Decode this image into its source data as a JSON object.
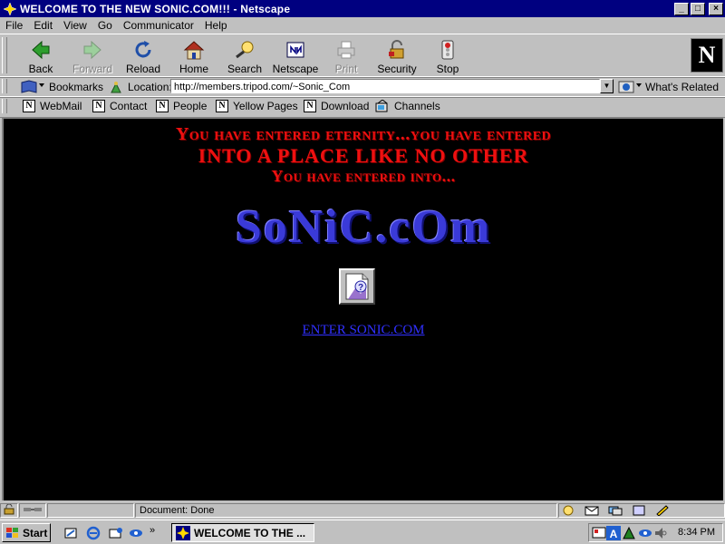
{
  "window": {
    "title": "WELCOME TO THE NEW SONIC.COM!!! - Netscape",
    "controls": {
      "minimize": "_",
      "maximize": "□",
      "close": "×"
    }
  },
  "menu": [
    "File",
    "Edit",
    "View",
    "Go",
    "Communicator",
    "Help"
  ],
  "toolbar": {
    "buttons": [
      {
        "label": "Back",
        "icon": "back-arrow-icon",
        "enabled": true
      },
      {
        "label": "Forward",
        "icon": "forward-arrow-icon",
        "enabled": false
      },
      {
        "label": "Reload",
        "icon": "reload-icon",
        "enabled": true
      },
      {
        "label": "Home",
        "icon": "home-icon",
        "enabled": true
      },
      {
        "label": "Search",
        "icon": "search-icon",
        "enabled": true
      },
      {
        "label": "Netscape",
        "icon": "netscape-icon",
        "enabled": true
      },
      {
        "label": "Print",
        "icon": "print-icon",
        "enabled": false
      },
      {
        "label": "Security",
        "icon": "lock-icon",
        "enabled": true
      },
      {
        "label": "Stop",
        "icon": "stop-icon",
        "enabled": true
      }
    ],
    "logo": "N"
  },
  "location_bar": {
    "bookmarks_label": "Bookmarks",
    "location_label": "Location:",
    "url": "http://members.tripod.com/~Sonic_Com",
    "whats_related": "What's Related"
  },
  "personal_toolbar": [
    "WebMail",
    "Contact",
    "People",
    "Yellow Pages",
    "Download",
    "Channels"
  ],
  "page": {
    "line1": "You have entered eternity...you have entered",
    "line2": "INTO A PLACE LIKE NO OTHER",
    "line3": "You have entered into...",
    "logo_text": "SoNiC.cOm",
    "enter_link": "ENTER SONIC.COM",
    "colors": {
      "background": "#000000",
      "headline": "#ee1010",
      "logo": "#3a3ad8",
      "link": "#3030ff"
    }
  },
  "status": {
    "text": "Document: Done"
  },
  "taskbar": {
    "start_label": "Start",
    "task_label": "WELCOME TO THE ...",
    "clock": "8:34 PM"
  }
}
